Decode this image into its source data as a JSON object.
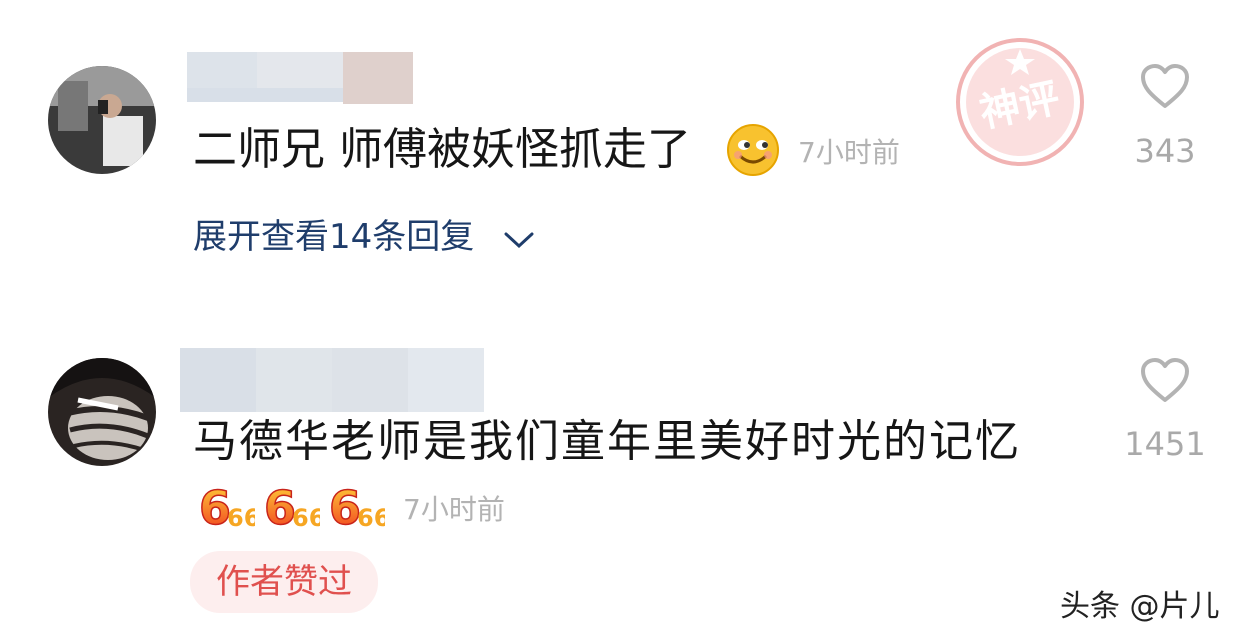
{
  "comments": [
    {
      "text": "二师兄 师傅被妖怪抓走了",
      "emoji": "smile-face-icon",
      "time": "7小时前",
      "expand_label": "展开查看14条回复",
      "likes": "343",
      "stamp_text": "神评"
    },
    {
      "text": "马德华老师是我们童年里美好时光的记忆",
      "emojis": [
        "666-icon",
        "666-icon",
        "666-icon"
      ],
      "emoji_text": "6",
      "emoji_text_small": "6",
      "time": "7小时前",
      "likes": "1451",
      "author_badge": "作者赞过"
    }
  ],
  "watermark": "头条 @片儿",
  "colors": {
    "link_blue": "#1f3d6b",
    "stamp_red": "#f1b3b3",
    "badge_bg": "#fdeeee",
    "badge_text": "#e0504e",
    "muted": "#b3b3b3"
  }
}
